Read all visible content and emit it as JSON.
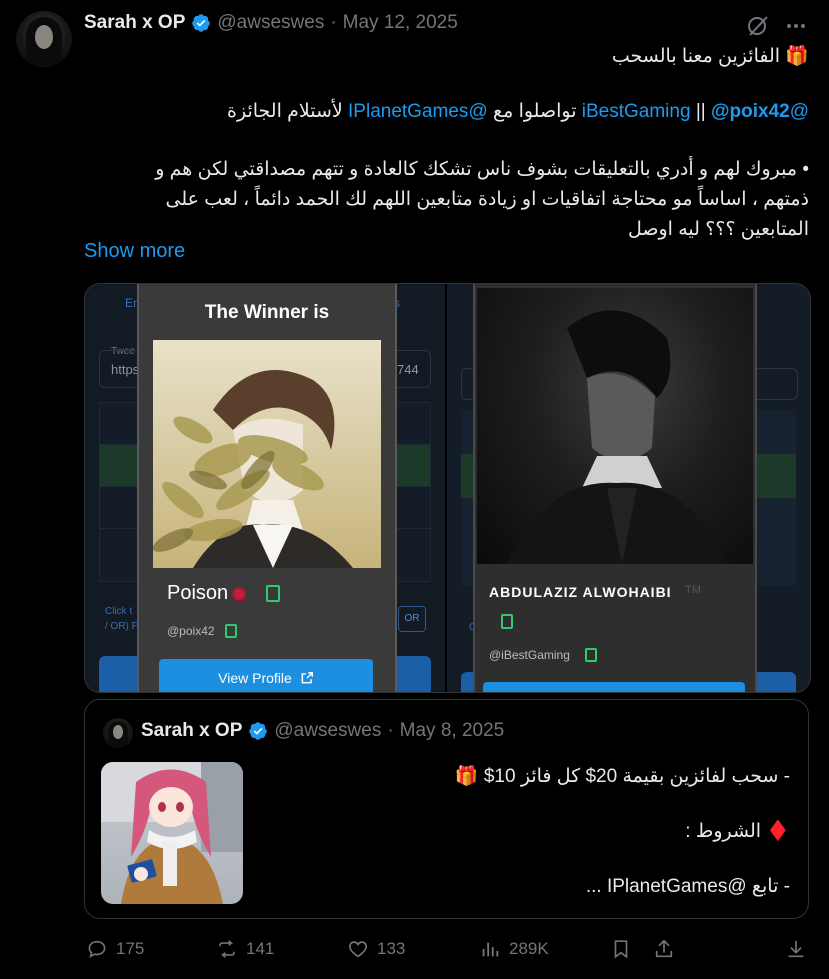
{
  "tweet": {
    "name": "Sarah x OP",
    "handle": "@awseswes",
    "sep": "·",
    "date": "May 12, 2025",
    "line1_text": "الفائزين معنا بالسحب",
    "line1_emoji": "🎁",
    "line2_mention1": "@iBestGaming",
    "line2_sep": "||",
    "line2_mention2": "@poix42",
    "line2_mid": "تواصلوا مع",
    "line2_mention3": "@IPlanetGames",
    "line2_end": "لأستلام الجائزة",
    "para_line1": "• مبروك لهم و أدري بالتعليقات بشوف ناس تشكك كالعادة و تتهم مصداقتي لكن هم و",
    "para_line2": "ذمتهم ، اساساً مو محتاجة اتفاقيات او زيادة متابعين اللهم لك الحمد دائماً ، لعب على",
    "para_line3": "المتابعين ؟؟؟ ليه اوصل",
    "show_more": "Show more"
  },
  "media": {
    "left_card": {
      "title": "The Winner is",
      "name": "Poison",
      "handle": "@poix42",
      "button": "View Profile",
      "bg_tab_text": "En",
      "bg_tab_text2": "rs",
      "bg_field_label": "Twee",
      "bg_field_value": "https",
      "bg_field_value2": "744",
      "bg_click_text": "Click t",
      "bg_or_text": "/ OR) F",
      "bg_or_button": "OR"
    },
    "right_card": {
      "name": "ABDULAZIZ ALWOHAIBI",
      "handle": "@iBestGaming",
      "bg_text": "TM",
      "bg_c": "C"
    }
  },
  "quote": {
    "name": "Sarah x OP",
    "handle": "@awseswes",
    "sep": "·",
    "date": "May 8, 2025",
    "line1": "- سحب لفائزين بقيمة 20$ كل فائز 10$",
    "line1_emoji": "🎁",
    "line2": "الشروط :",
    "line2_emoji": "♦️",
    "line3": "- تابع @IPlanetGames ..."
  },
  "actions": {
    "replies": "175",
    "reposts": "141",
    "likes": "133",
    "views": "289K"
  },
  "colors": {
    "accent": "#1d9bf0",
    "text": "#e7e9ea",
    "muted": "#71767b",
    "border": "#2f3336"
  }
}
